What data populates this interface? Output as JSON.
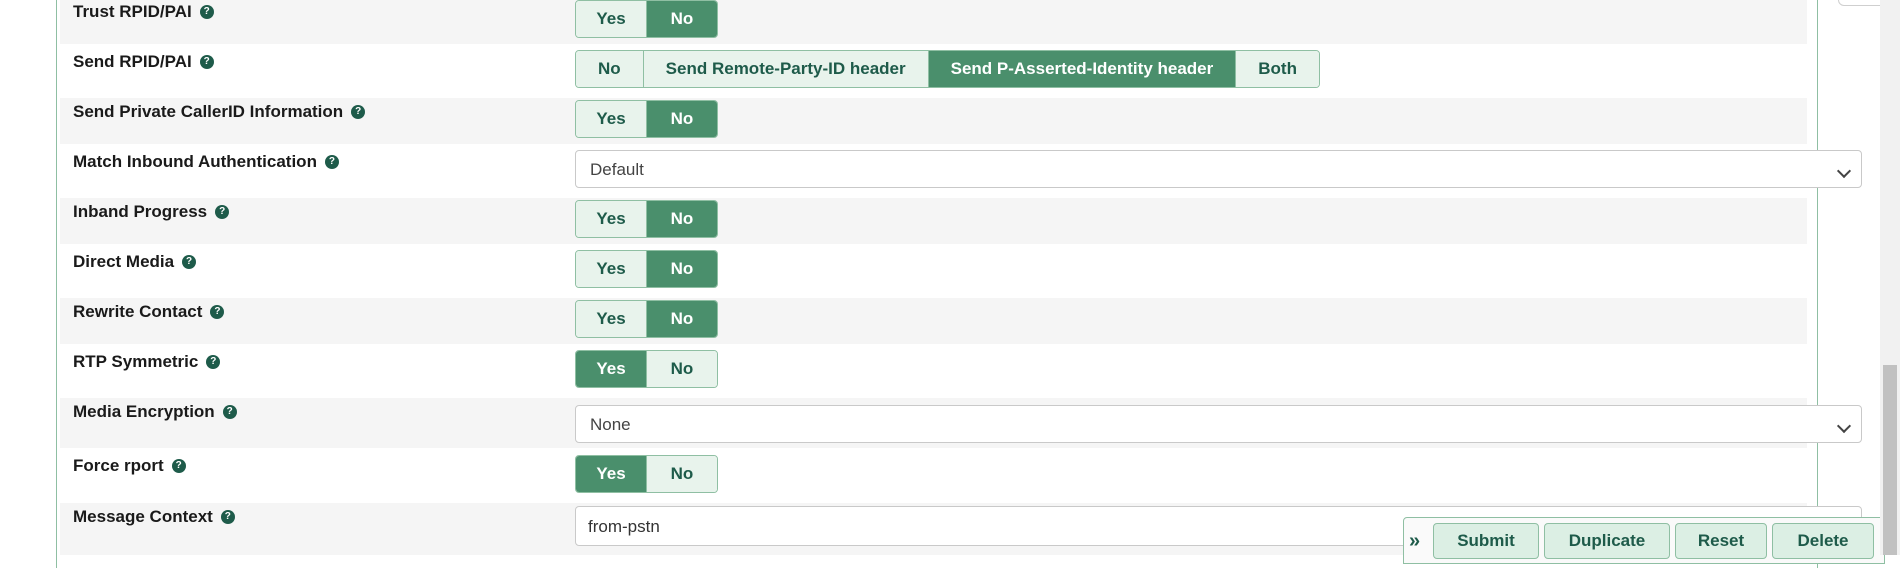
{
  "rows": [
    {
      "label": "Trust RPID/PAI",
      "type": "toggle",
      "options": [
        "Yes",
        "No"
      ],
      "selected": "No"
    },
    {
      "label": "Send RPID/PAI",
      "type": "segmented",
      "options": [
        "No",
        "Send Remote-Party-ID header",
        "Send P-Asserted-Identity header",
        "Both"
      ],
      "selected": "Send P-Asserted-Identity header"
    },
    {
      "label": "Send Private CallerID Information",
      "type": "toggle",
      "options": [
        "Yes",
        "No"
      ],
      "selected": "No"
    },
    {
      "label": "Match Inbound Authentication",
      "type": "select",
      "value": "Default"
    },
    {
      "label": "Inband Progress",
      "type": "toggle",
      "options": [
        "Yes",
        "No"
      ],
      "selected": "No"
    },
    {
      "label": "Direct Media",
      "type": "toggle",
      "options": [
        "Yes",
        "No"
      ],
      "selected": "No"
    },
    {
      "label": "Rewrite Contact",
      "type": "toggle",
      "options": [
        "Yes",
        "No"
      ],
      "selected": "No"
    },
    {
      "label": "RTP Symmetric",
      "type": "toggle",
      "options": [
        "Yes",
        "No"
      ],
      "selected": "Yes"
    },
    {
      "label": "Media Encryption",
      "type": "select",
      "value": "None"
    },
    {
      "label": "Force rport",
      "type": "toggle",
      "options": [
        "Yes",
        "No"
      ],
      "selected": "Yes"
    },
    {
      "label": "Message Context",
      "type": "text",
      "value": "from-pstn"
    }
  ],
  "help_glyph": "?",
  "actions": {
    "collapse_glyph": "»",
    "submit": "Submit",
    "duplicate": "Duplicate",
    "reset": "Reset",
    "delete": "Delete"
  },
  "colors": {
    "accent": "#4a8f6c",
    "accent_light": "#e8f3ec",
    "text_accent": "#1e5b4a"
  }
}
